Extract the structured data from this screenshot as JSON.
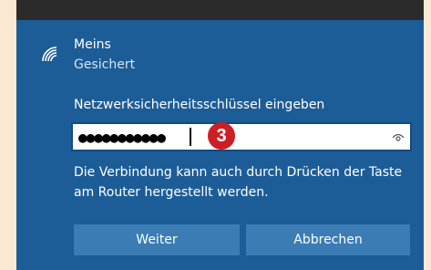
{
  "network": {
    "name": "Meins",
    "status": "Gesichert",
    "wifi_icon": "wifi-signal-icon"
  },
  "security_key": {
    "label": "Netzwerksicherheitsschlüssel eingeben",
    "masked_value": "●●●●●●●●●●●",
    "reveal_icon": "eye-icon"
  },
  "annotation": {
    "step_number": "3"
  },
  "hint_text": "Die Verbindung kann auch durch Drücken der Taste am Router hergestellt werden.",
  "buttons": {
    "next_label": "Weiter",
    "cancel_label": "Abbrechen"
  },
  "colors": {
    "panel_background": "#1d5d97",
    "button_background": "#3b7cb5",
    "badge_red": "#cc1f24",
    "page_background": "#fbe8d3"
  }
}
